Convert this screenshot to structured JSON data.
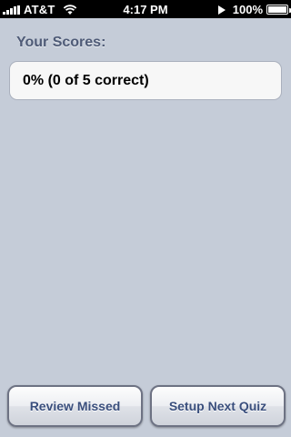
{
  "status_bar": {
    "carrier": "AT&T",
    "time": "4:17 PM",
    "battery_percent": "100%",
    "battery_level": 1.0
  },
  "main": {
    "section_title": "Your Scores:",
    "score_text": "0% (0 of 5 correct)"
  },
  "buttons": {
    "review_label": "Review Missed",
    "setup_label": "Setup Next Quiz"
  },
  "colors": {
    "background": "#c5ccd8",
    "title_text": "#4f5b77",
    "button_text": "#3a4f7d"
  }
}
